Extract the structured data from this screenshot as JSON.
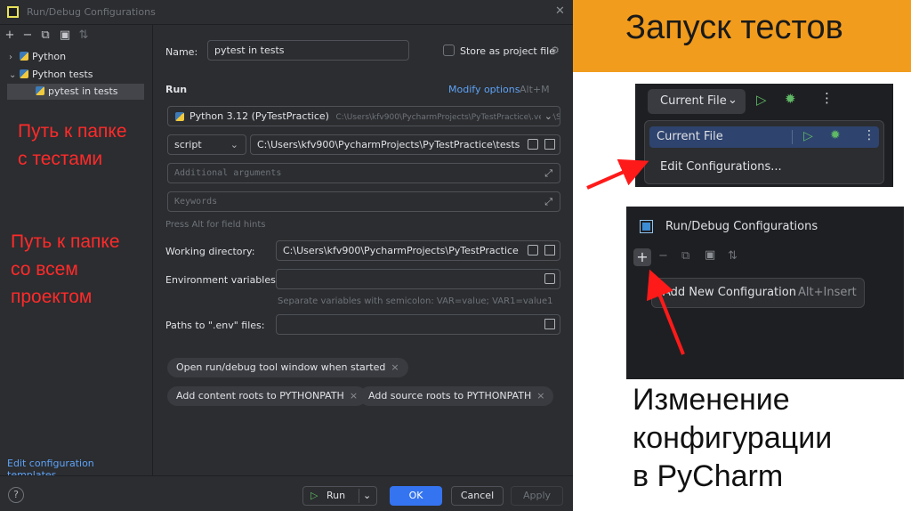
{
  "dialog": {
    "title": "Run/Debug Configurations",
    "close": "✕",
    "toolbar": {
      "add": "+",
      "remove": "−",
      "copy": "⧉",
      "folder": "▣",
      "sort": "⇅"
    },
    "tree": [
      {
        "label": "Python",
        "chevron": "›"
      },
      {
        "label": "Python tests",
        "chevron": "⌄"
      },
      {
        "label": "pytest in tests"
      }
    ],
    "edit_templates": "Edit configuration templates...",
    "notes": {
      "tests_folder": [
        "Путь к папке",
        "с тестами"
      ],
      "project_folder": [
        "Путь к папке",
        "со всем",
        "проектом"
      ]
    },
    "form": {
      "name_label": "Name:",
      "name_value": "pytest in tests",
      "store_label": "Store as project file",
      "run_section": "Run",
      "modify_options": "Modify options",
      "modify_shortcut": "Alt+M",
      "interpreter": "Python 3.12 (PyTestPractice)",
      "interpreter_path": "C:\\Users\\kfv900\\PycharmProjects\\PyTestPractice\\.venv\\S",
      "target_type": "script",
      "target_path": "C:\\Users\\kfv900\\PycharmProjects\\PyTestPractice\\tests",
      "additional_args_placeholder": "Additional arguments",
      "keywords_placeholder": "Keywords",
      "alt_hint": "Press Alt for field hints",
      "working_dir_label": "Working directory:",
      "working_dir_value": "C:\\Users\\kfv900\\PycharmProjects\\PyTestPractice",
      "env_label": "Environment variables:",
      "env_hint": "Separate variables with semicolon: VAR=value; VAR1=value1",
      "dotenv_label": "Paths to \".env\" files:",
      "chips": [
        "Open run/debug tool window when started",
        "Add content roots to PYTHONPATH",
        "Add source roots to PYTHONPATH"
      ]
    },
    "buttons": {
      "help": "?",
      "run": "Run",
      "ok": "OK",
      "cancel": "Cancel",
      "apply": "Apply"
    }
  },
  "slide": {
    "title": "Запуск тестов",
    "caption": [
      "Изменение",
      "конфигурации",
      "в PyCharm"
    ]
  },
  "shot1": {
    "selector": "Current File",
    "menu_item": "Current File",
    "edit_item": "Edit Configurations..."
  },
  "shot2": {
    "title": "Run/Debug Configurations",
    "popup_item": "Add New Configuration",
    "popup_shortcut": "Alt+Insert"
  },
  "colors": {
    "accent_orange": "#f29c1d",
    "annotation_red": "#ff2a2a",
    "run_green": "#5fb865",
    "link_blue": "#5ea2f7"
  }
}
